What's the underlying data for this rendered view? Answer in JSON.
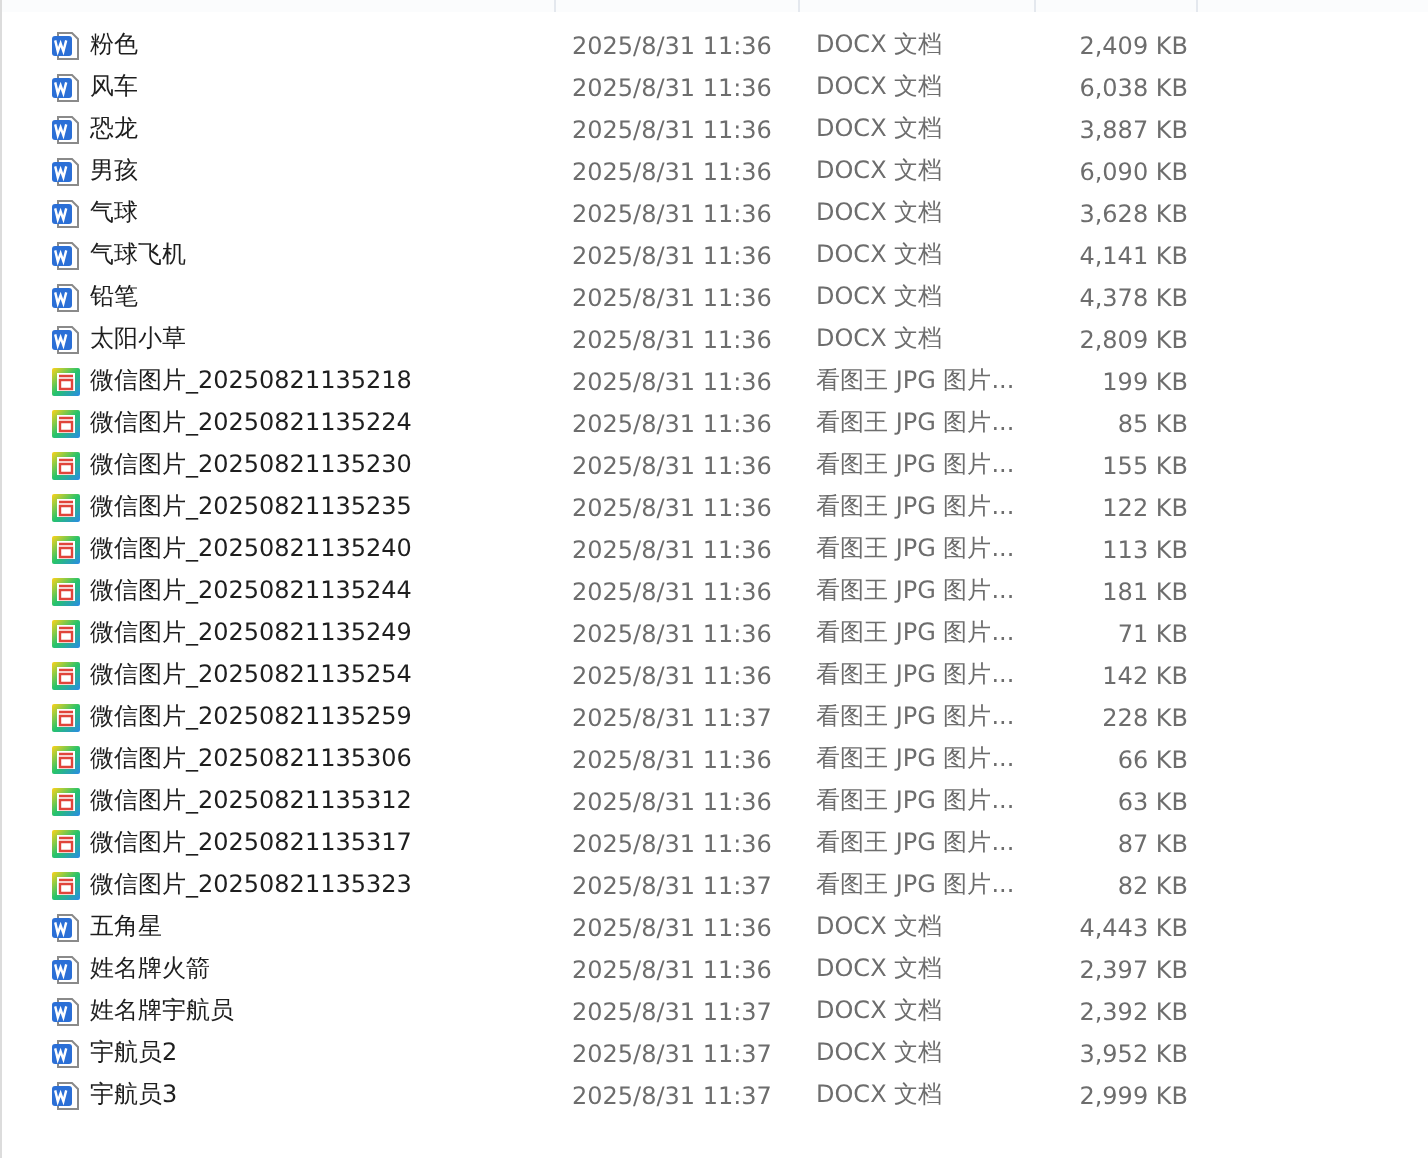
{
  "files": [
    {
      "kind": "docx",
      "name": "粉色",
      "modified": "2025/8/31 11:36",
      "type": "DOCX 文档",
      "size": "2,409 KB"
    },
    {
      "kind": "docx",
      "name": "风车",
      "modified": "2025/8/31 11:36",
      "type": "DOCX 文档",
      "size": "6,038 KB"
    },
    {
      "kind": "docx",
      "name": "恐龙",
      "modified": "2025/8/31 11:36",
      "type": "DOCX 文档",
      "size": "3,887 KB"
    },
    {
      "kind": "docx",
      "name": "男孩",
      "modified": "2025/8/31 11:36",
      "type": "DOCX 文档",
      "size": "6,090 KB"
    },
    {
      "kind": "docx",
      "name": "气球",
      "modified": "2025/8/31 11:36",
      "type": "DOCX 文档",
      "size": "3,628 KB"
    },
    {
      "kind": "docx",
      "name": "气球飞机",
      "modified": "2025/8/31 11:36",
      "type": "DOCX 文档",
      "size": "4,141 KB"
    },
    {
      "kind": "docx",
      "name": "铅笔",
      "modified": "2025/8/31 11:36",
      "type": "DOCX 文档",
      "size": "4,378 KB"
    },
    {
      "kind": "docx",
      "name": "太阳小草",
      "modified": "2025/8/31 11:36",
      "type": "DOCX 文档",
      "size": "2,809 KB"
    },
    {
      "kind": "image",
      "name": "微信图片_20250821135218",
      "modified": "2025/8/31 11:36",
      "type": "看图王 JPG 图片...",
      "size": "199 KB"
    },
    {
      "kind": "image",
      "name": "微信图片_20250821135224",
      "modified": "2025/8/31 11:36",
      "type": "看图王 JPG 图片...",
      "size": "85 KB"
    },
    {
      "kind": "image",
      "name": "微信图片_20250821135230",
      "modified": "2025/8/31 11:36",
      "type": "看图王 JPG 图片...",
      "size": "155 KB"
    },
    {
      "kind": "image",
      "name": "微信图片_20250821135235",
      "modified": "2025/8/31 11:36",
      "type": "看图王 JPG 图片...",
      "size": "122 KB"
    },
    {
      "kind": "image",
      "name": "微信图片_20250821135240",
      "modified": "2025/8/31 11:36",
      "type": "看图王 JPG 图片...",
      "size": "113 KB"
    },
    {
      "kind": "image",
      "name": "微信图片_20250821135244",
      "modified": "2025/8/31 11:36",
      "type": "看图王 JPG 图片...",
      "size": "181 KB"
    },
    {
      "kind": "image",
      "name": "微信图片_20250821135249",
      "modified": "2025/8/31 11:36",
      "type": "看图王 JPG 图片...",
      "size": "71 KB"
    },
    {
      "kind": "image",
      "name": "微信图片_20250821135254",
      "modified": "2025/8/31 11:36",
      "type": "看图王 JPG 图片...",
      "size": "142 KB"
    },
    {
      "kind": "image",
      "name": "微信图片_20250821135259",
      "modified": "2025/8/31 11:37",
      "type": "看图王 JPG 图片...",
      "size": "228 KB"
    },
    {
      "kind": "image",
      "name": "微信图片_20250821135306",
      "modified": "2025/8/31 11:36",
      "type": "看图王 JPG 图片...",
      "size": "66 KB"
    },
    {
      "kind": "image",
      "name": "微信图片_20250821135312",
      "modified": "2025/8/31 11:36",
      "type": "看图王 JPG 图片...",
      "size": "63 KB"
    },
    {
      "kind": "image",
      "name": "微信图片_20250821135317",
      "modified": "2025/8/31 11:36",
      "type": "看图王 JPG 图片...",
      "size": "87 KB"
    },
    {
      "kind": "image",
      "name": "微信图片_20250821135323",
      "modified": "2025/8/31 11:37",
      "type": "看图王 JPG 图片...",
      "size": "82 KB"
    },
    {
      "kind": "docx",
      "name": "五角星",
      "modified": "2025/8/31 11:36",
      "type": "DOCX 文档",
      "size": "4,443 KB"
    },
    {
      "kind": "docx",
      "name": "姓名牌火箭",
      "modified": "2025/8/31 11:36",
      "type": "DOCX 文档",
      "size": "2,397 KB"
    },
    {
      "kind": "docx",
      "name": "姓名牌宇航员",
      "modified": "2025/8/31 11:37",
      "type": "DOCX 文档",
      "size": "2,392 KB"
    },
    {
      "kind": "docx",
      "name": "宇航员2",
      "modified": "2025/8/31 11:37",
      "type": "DOCX 文档",
      "size": "3,952 KB"
    },
    {
      "kind": "docx",
      "name": "宇航员3",
      "modified": "2025/8/31 11:37",
      "type": "DOCX 文档",
      "size": "2,999 KB"
    }
  ]
}
